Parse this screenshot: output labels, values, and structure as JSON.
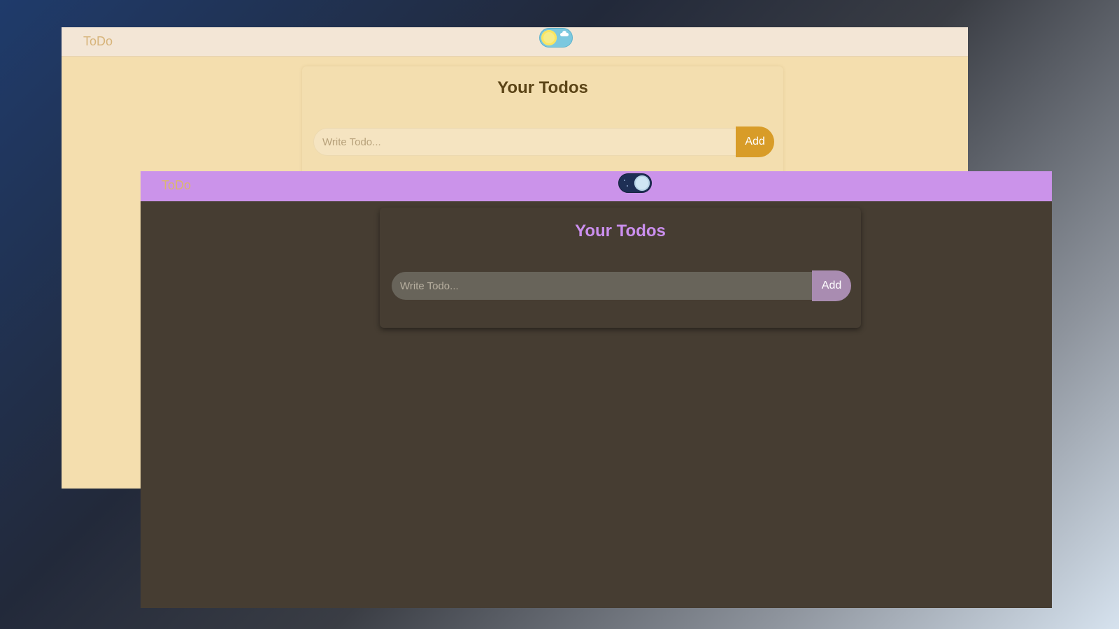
{
  "light_window": {
    "brand": "ToDo",
    "theme": "light",
    "title": "Your Todos",
    "input_placeholder": "Write Todo...",
    "input_value": "",
    "add_label": "Add",
    "colors": {
      "navbar": "#f3e6d6",
      "background": "#f4deae",
      "title": "#5b4416",
      "add_button": "#d89c28",
      "toggle": "#7cc8df"
    },
    "toggle_icon": "sun-icon"
  },
  "dark_window": {
    "brand": "ToDo",
    "theme": "dark",
    "title": "Your Todos",
    "input_placeholder": "Write Todo...",
    "input_value": "",
    "add_label": "Add",
    "colors": {
      "navbar": "#cb93ea",
      "background": "#463d32",
      "title": "#cb8fee",
      "add_button": "#a98cb1",
      "toggle": "#1e2f55"
    },
    "toggle_icon": "moon-icon"
  }
}
